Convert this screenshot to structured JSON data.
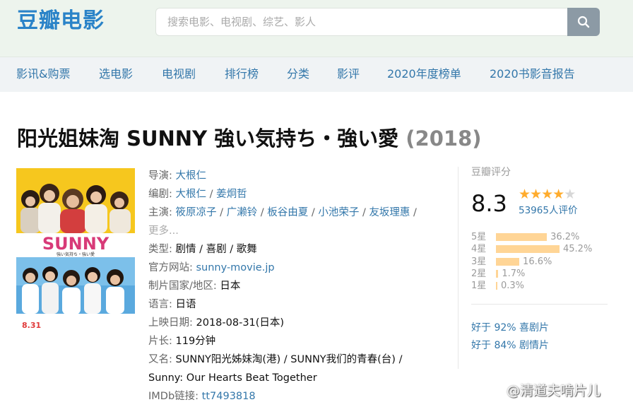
{
  "header": {
    "logo": "豆瓣电影",
    "search_placeholder": "搜索电影、电视剧、综艺、影人",
    "search_icon": "search-icon"
  },
  "nav": {
    "items": [
      "影讯&购票",
      "选电影",
      "电视剧",
      "排行榜",
      "分类",
      "影评",
      "2020年度榜单",
      "2020书影音报告"
    ]
  },
  "movie": {
    "title": "阳光姐妹淘 SUNNY 強い気持ち・強い愛",
    "year": "(2018)",
    "poster": {
      "title": "SUNNY",
      "subtitle": "強い気持ち・強い愛",
      "date": "8.31"
    },
    "info": {
      "director_label": "导演:",
      "directors": [
        "大根仁"
      ],
      "writer_label": "编剧:",
      "writers": [
        "大根仁",
        "姜炯哲"
      ],
      "cast_label": "主演:",
      "cast": [
        "筱原凉子",
        "广濑铃",
        "板谷由夏",
        "小池荣子",
        "友坂理惠"
      ],
      "more": "更多...",
      "genre_label": "类型:",
      "genres": "剧情 / 喜剧 / 歌舞",
      "site_label": "官方网站:",
      "site": "sunny-movie.jp",
      "country_label": "制片国家/地区:",
      "country": "日本",
      "language_label": "语言:",
      "language": "日语",
      "release_label": "上映日期:",
      "release": "2018-08-31(日本)",
      "runtime_label": "片长:",
      "runtime": "119分钟",
      "aka_label": "又名:",
      "aka_line1": "SUNNY阳光姊妹淘(港) / SUNNY我们的青春(台) /",
      "aka_line2": "Sunny: Our Hearts Beat Together",
      "imdb_label": "IMDb链接:",
      "imdb": "tt7493818"
    }
  },
  "rating": {
    "label": "豆瓣评分",
    "score": "8.3",
    "stars_filled": 4,
    "stars_total": 5,
    "votes": "53965人评价",
    "distribution": [
      {
        "label": "5星",
        "percent": "36.2%",
        "value": 36.2
      },
      {
        "label": "4星",
        "percent": "45.2%",
        "value": 45.2
      },
      {
        "label": "3星",
        "percent": "16.6%",
        "value": 16.6
      },
      {
        "label": "2星",
        "percent": "1.7%",
        "value": 1.7
      },
      {
        "label": "1星",
        "percent": "0.3%",
        "value": 0.3
      }
    ],
    "better_than": [
      {
        "prefix": "好于",
        "percent": "92%",
        "genre": "喜剧片"
      },
      {
        "prefix": "好于",
        "percent": "84%",
        "genre": "剧情片"
      }
    ]
  },
  "watermark": "@清道夫啃片儿",
  "colors": {
    "link": "#3377aa",
    "star": "#ffac2d",
    "bar": "#ffd596",
    "header_bg": "#edf4ed",
    "nav_bg": "#f0f3f5",
    "poster_yellow": "#f6c71e",
    "poster_blue": "#5aa9de"
  }
}
